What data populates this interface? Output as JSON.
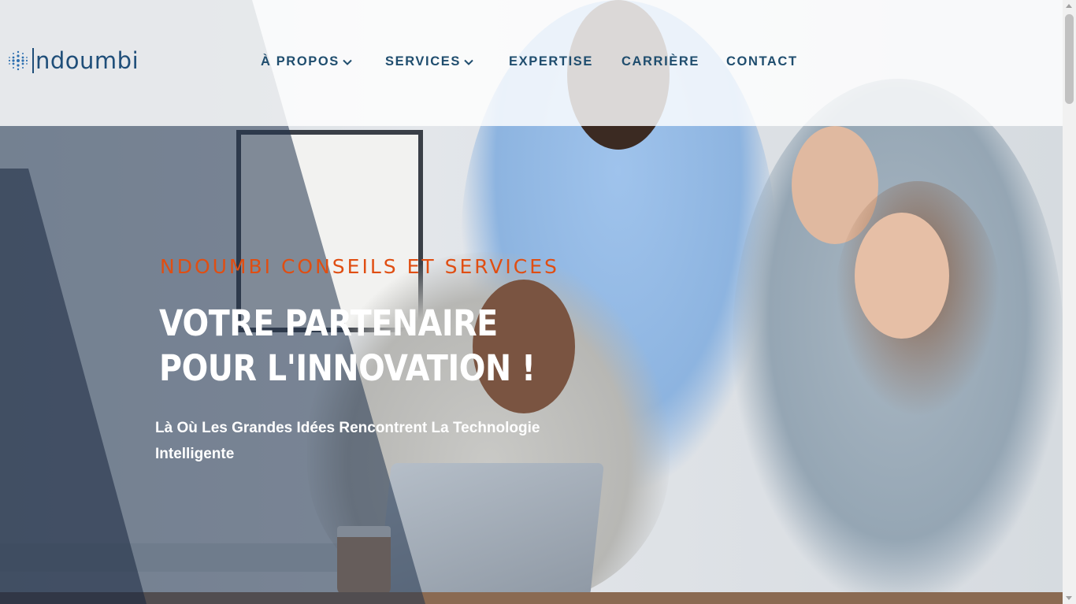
{
  "brand": {
    "name": "ndoumbi",
    "logo_icon": "dotted-sphere-icon",
    "color": "#1f4e79"
  },
  "nav": {
    "items": [
      {
        "label": "À PROPOS",
        "has_dropdown": true
      },
      {
        "label": "SERVICES",
        "has_dropdown": true
      },
      {
        "label": "EXPERTISE",
        "has_dropdown": false
      },
      {
        "label": "CARRIÈRE",
        "has_dropdown": false
      },
      {
        "label": "CONTACT",
        "has_dropdown": false
      }
    ],
    "color": "#1f4d6e"
  },
  "hero": {
    "kicker": "NDOUMBI CONSEILS ET SERVICES",
    "headline_line1": "VOTRE PARTENAIRE",
    "headline_line2": "POUR L'INNOVATION !",
    "subline_line1": "Là Où Les Grandes Idées Rencontrent La Technologie",
    "subline_line2": "Intelligente",
    "kicker_color": "#e04e12"
  }
}
